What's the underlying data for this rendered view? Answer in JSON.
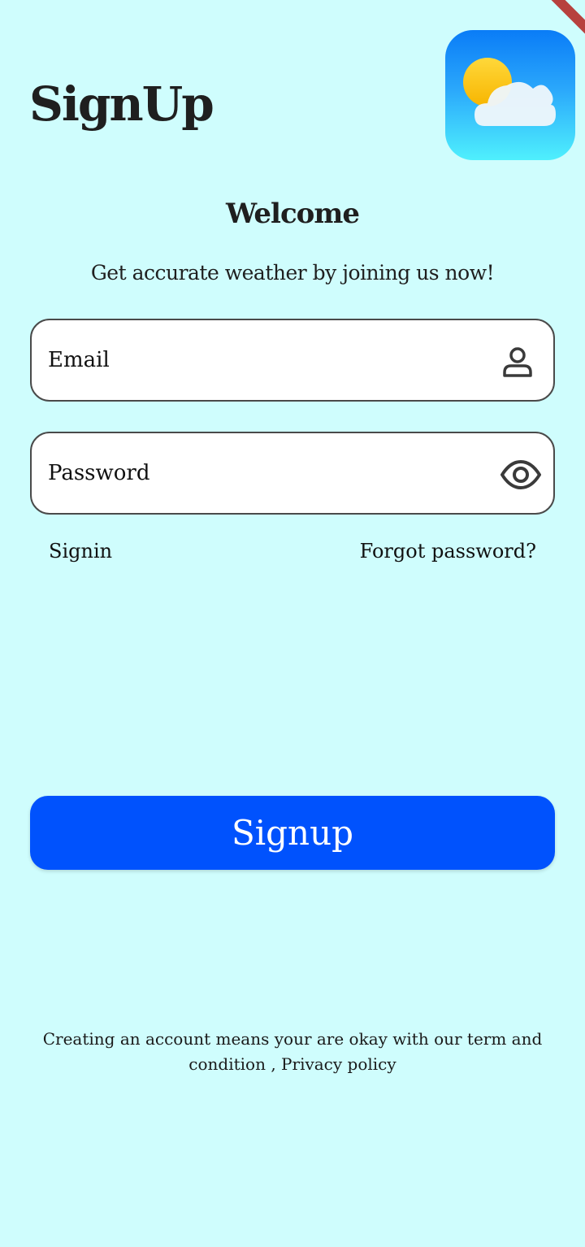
{
  "header": {
    "title": "SignUp",
    "logo_icon": "weather-sun-cloud-icon"
  },
  "welcome": {
    "heading": "Welcome",
    "subtitle": "Get accurate weather by joining us now!"
  },
  "form": {
    "email": {
      "placeholder": "Email",
      "value": "",
      "icon": "person-icon"
    },
    "password": {
      "placeholder": "Password",
      "value": "",
      "icon": "eye-icon"
    }
  },
  "links": {
    "signin": "Signin",
    "forgot_password": "Forgot password?"
  },
  "actions": {
    "signup_label": "Signup"
  },
  "footer": {
    "terms": "Creating an account means your are okay with our term and condition , Privacy policy"
  },
  "colors": {
    "background": "#cffdfd",
    "primary_button": "#0052fd",
    "text": "#1f1f1f",
    "field_border": "#4a4a4a"
  }
}
